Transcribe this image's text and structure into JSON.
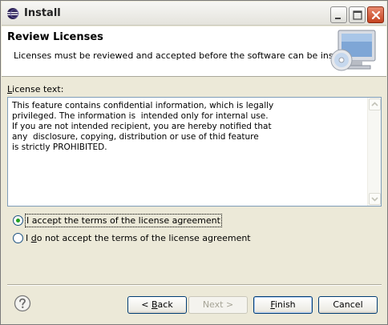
{
  "window": {
    "title": "Install"
  },
  "banner": {
    "title": "Review Licenses",
    "description": "Licenses must be reviewed and accepted before the software can be installed."
  },
  "license": {
    "label_mnemonic": "L",
    "label_rest": "icense text:",
    "text": "This feature contains confidential information, which is legally\nprivileged. The information is  intended only for internal use.\nIf you are not intended recipient, you are hereby notified that\nany  disclosure, copying, distribution or use of thid feature\nis strictly PROHIBITED."
  },
  "options": {
    "accept_label": "I accept the terms of the license agreement",
    "decline_prefix": "I ",
    "decline_mnemonic": "d",
    "decline_rest": "o not accept the terms of the license agreement",
    "selected": "accept"
  },
  "buttons": {
    "back_prefix": "< ",
    "back_mnemonic": "B",
    "back_rest": "ack",
    "next_label": "Next >",
    "finish_mnemonic": "F",
    "finish_rest": "inish",
    "cancel_label": "Cancel"
  },
  "colors": {
    "radio_selected": "#21a121",
    "button_border": "#003c74",
    "disabled_text": "#a6a496"
  }
}
